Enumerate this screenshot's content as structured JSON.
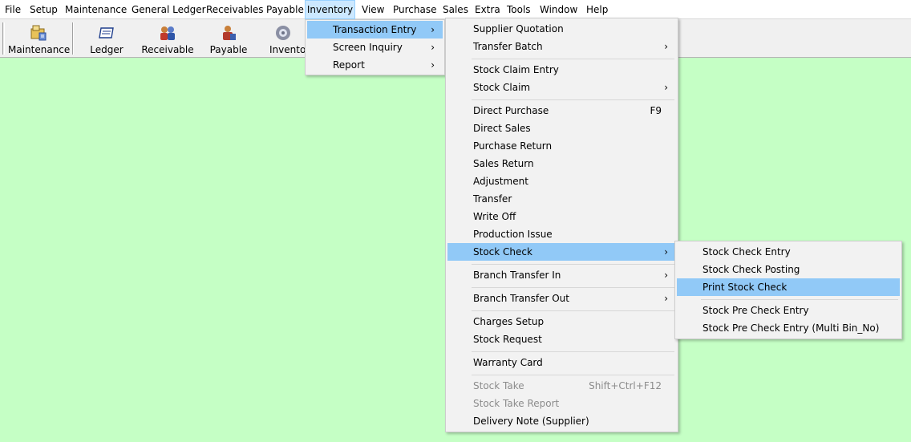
{
  "menubar": [
    "File",
    "Setup",
    "Maintenance",
    "General Ledger",
    "Receivables",
    "Payable",
    "Inventory",
    "View",
    "Purchase",
    "Sales",
    "Extra",
    "Tools",
    "Window",
    "Help"
  ],
  "toolbar": {
    "maintenance": "Maintenance",
    "ledger": "Ledger",
    "receivable": "Receivable",
    "payable": "Payable",
    "inventory": "Inventor"
  },
  "inventory_menu": {
    "transaction_entry": "Transaction Entry",
    "screen_inquiry": "Screen Inquiry",
    "report": "Report"
  },
  "transaction_menu": {
    "supplier_quotation": "Supplier Quotation",
    "transfer_batch": "Transfer Batch",
    "stock_claim_entry": "Stock Claim Entry",
    "stock_claim": "Stock Claim",
    "direct_purchase": "Direct Purchase",
    "direct_purchase_shortcut": "F9",
    "direct_sales": "Direct Sales",
    "purchase_return": "Purchase Return",
    "sales_return": "Sales Return",
    "adjustment": "Adjustment",
    "transfer": "Transfer",
    "write_off": "Write Off",
    "production_issue": "Production Issue",
    "stock_check": "Stock Check",
    "branch_transfer_in": "Branch Transfer In",
    "branch_transfer_out": "Branch Transfer Out",
    "charges_setup": "Charges Setup",
    "stock_request": "Stock Request",
    "warranty_card": "Warranty Card",
    "stock_take": "Stock Take",
    "stock_take_shortcut": "Shift+Ctrl+F12",
    "stock_take_report": "Stock Take Report",
    "delivery_note": "Delivery Note (Supplier)"
  },
  "stock_check_menu": {
    "stock_check_entry": "Stock Check Entry",
    "stock_check_posting": "Stock Check Posting",
    "print_stock_check": "Print Stock Check",
    "stock_pre_check_entry": "Stock Pre Check Entry",
    "stock_pre_check_entry_multi": "Stock Pre Check Entry (Multi Bin_No)"
  },
  "colors": {
    "background": "#c5ffc5",
    "highlight": "#91c9f7",
    "menu_active": "#cce8ff"
  },
  "icons": [
    "maintenance-icon",
    "ledger-icon",
    "receivable-icon",
    "payable-icon",
    "inventory-icon",
    "submenu-arrow-icon"
  ]
}
